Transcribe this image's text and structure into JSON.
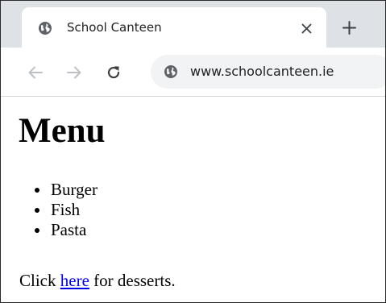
{
  "browser": {
    "tab": {
      "title": "School Canteen",
      "favicon_icon": "globe-icon",
      "close_icon": "close-icon"
    },
    "new_tab_icon": "plus-icon",
    "toolbar": {
      "back_icon": "arrow-left-icon",
      "forward_icon": "arrow-right-icon",
      "reload_icon": "reload-icon",
      "site_icon": "globe-icon",
      "url": "www.schoolcanteen.ie"
    },
    "colors": {
      "tabstrip": "#dee1e6",
      "omnibox": "#f1f3f4",
      "link": "#0000ee"
    }
  },
  "page": {
    "heading": "Menu",
    "menu_items": [
      "Burger",
      "Fish",
      "Pasta"
    ],
    "footer": {
      "before": "Click ",
      "link_text": "here",
      "after": " for desserts."
    }
  }
}
